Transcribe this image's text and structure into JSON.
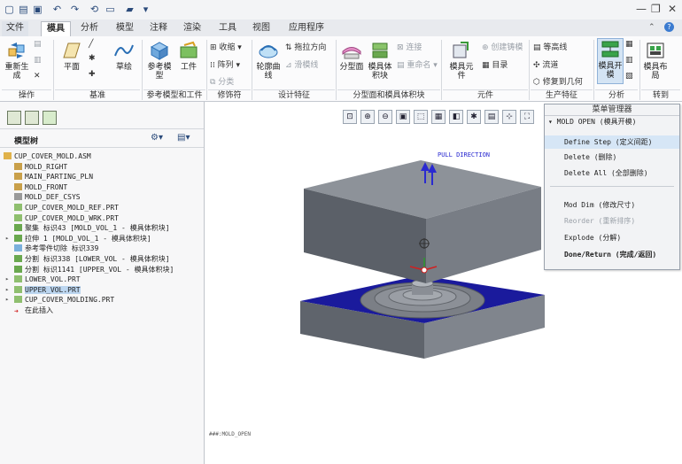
{
  "quick_access": {
    "icons": [
      "new-icon",
      "open-icon",
      "save-icon",
      "undo-icon",
      "redo-icon",
      "regenerate-icon",
      "window-icon",
      "folder-icon",
      "dropdown-icon"
    ]
  },
  "window_controls": {
    "min": "—",
    "restore": "❐",
    "close": "✕"
  },
  "help": {
    "minimize_ribbon": "⌃",
    "help": "?"
  },
  "tabs": [
    {
      "label": "文件",
      "active": false
    },
    {
      "label": "模具",
      "active": true
    },
    {
      "label": "分析",
      "active": false
    },
    {
      "label": "模型",
      "active": false
    },
    {
      "label": "注释",
      "active": false
    },
    {
      "label": "渲染",
      "active": false
    },
    {
      "label": "工具",
      "active": false
    },
    {
      "label": "视图",
      "active": false
    },
    {
      "label": "应用程序",
      "active": false
    }
  ],
  "ribbon": {
    "operations": {
      "regenerate": "重新生成",
      "group": "操作"
    },
    "datum": {
      "plane": "平面",
      "sketch": "草绘",
      "group": "基准"
    },
    "reference": {
      "ref_model": "参考模型",
      "workpiece": "工件",
      "group": "参考模型和工件"
    },
    "modifiers": {
      "shrink": "收缩",
      "pattern": "阵列",
      "split": "分类",
      "group": "修饰符"
    },
    "design": {
      "silhouette": "轮廓曲线",
      "draft_dir": "拖拉方向",
      "slider": "滑模线",
      "group": "设计特征"
    },
    "parting": {
      "parting_surface": "分型面",
      "mold_volume": "模具体积块",
      "connect": "连接",
      "rename": "重命名",
      "group": "分型面和模具体积块"
    },
    "components": {
      "mold_comp": "模具元件",
      "create_casting": "创建铸模",
      "catalog": "目录",
      "group": "元件"
    },
    "production": {
      "contour": "等高线",
      "runner": "流道",
      "repair": "修复到几何",
      "group": "生产特征"
    },
    "analysis": {
      "mold_open": "模具开模",
      "group": "分析"
    },
    "transition": {
      "mold_layout": "模具布局",
      "group": "转到"
    }
  },
  "model_tree": {
    "title": "模型树",
    "items": [
      {
        "label": "CUP_COVER_MOLD.ASM",
        "indent": 0,
        "expand": "",
        "icon": "assembly-icon",
        "selected": false
      },
      {
        "label": "MOLD_RIGHT",
        "indent": 1,
        "expand": "",
        "icon": "plane-icon",
        "selected": false
      },
      {
        "label": "MAIN_PARTING_PLN",
        "indent": 1,
        "expand": "",
        "icon": "plane-icon",
        "selected": false
      },
      {
        "label": "MOLD_FRONT",
        "indent": 1,
        "expand": "",
        "icon": "plane-icon",
        "selected": false
      },
      {
        "label": "MOLD_DEF_CSYS",
        "indent": 1,
        "expand": "",
        "icon": "csys-icon",
        "selected": false
      },
      {
        "label": "CUP_COVER_MOLD_REF.PRT",
        "indent": 1,
        "expand": "",
        "icon": "part-icon",
        "selected": false
      },
      {
        "label": "CUP_COVER_MOLD_WRK.PRT",
        "indent": 1,
        "expand": "",
        "icon": "part-icon",
        "selected": false
      },
      {
        "label": "聚集 标识43 [MOLD_VOL_1 - 模具体积块]",
        "indent": 1,
        "expand": "",
        "icon": "volume-icon",
        "selected": false
      },
      {
        "label": "拉伸 1 [MOLD_VOL_1 - 模具体积块]",
        "indent": 1,
        "expand": "▸",
        "icon": "extrude-icon",
        "selected": false
      },
      {
        "label": "参考零件切除 标识339",
        "indent": 1,
        "expand": "",
        "icon": "cut-icon",
        "selected": false
      },
      {
        "label": "分割 标识338 [LOWER_VOL - 模具体积块]",
        "indent": 1,
        "expand": "",
        "icon": "split-icon",
        "selected": false
      },
      {
        "label": "分割 标识1141 [UPPER_VOL - 模具体积块]",
        "indent": 1,
        "expand": "",
        "icon": "split-icon",
        "selected": false
      },
      {
        "label": "LOWER_VOL.PRT",
        "indent": 1,
        "expand": "▸",
        "icon": "part-icon",
        "selected": false
      },
      {
        "label": "UPPER_VOL.PRT",
        "indent": 1,
        "expand": "▸",
        "icon": "part-icon",
        "selected": true
      },
      {
        "label": "CUP_COVER_MOLDING.PRT",
        "indent": 1,
        "expand": "▸",
        "icon": "part-icon",
        "selected": false
      },
      {
        "label": "在此插入",
        "indent": 1,
        "expand": "",
        "icon": "insert-arrow-icon",
        "selected": false
      }
    ]
  },
  "viewport": {
    "pull_direction": "PULL DIRECTION",
    "status": "###:MOLD_OPEN",
    "toolbar_icons": [
      "zoom-fit-icon",
      "zoom-in-icon",
      "zoom-out-icon",
      "repaint-icon",
      "orient-icon",
      "views-icon",
      "display-style-icon",
      "datum-display-icon",
      "annotation-icon",
      "spin-center-icon",
      "display-toggle-icon"
    ]
  },
  "menu_manager": {
    "title": "菜单管理器",
    "header": "MOLD OPEN (模具开模)",
    "items": [
      {
        "label": "Define Step (定义间距)",
        "state": "highlight"
      },
      {
        "label": "Delete (删除)",
        "state": "normal"
      },
      {
        "label": "Delete All (全部删除)",
        "state": "normal"
      },
      {
        "label": "Mod Dim (修改尺寸)",
        "state": "normal"
      },
      {
        "label": "Reorder (重新排序)",
        "state": "disabled"
      },
      {
        "label": "Explode (分解)",
        "state": "normal"
      },
      {
        "label": "Done/Return (完成/返回)",
        "state": "bold"
      }
    ]
  },
  "colors": {
    "mold_gray": "#6e737b",
    "mold_top": "#8a8f96",
    "cavity_blue": "#1a1a9c",
    "accent": "#2a6fb5"
  }
}
